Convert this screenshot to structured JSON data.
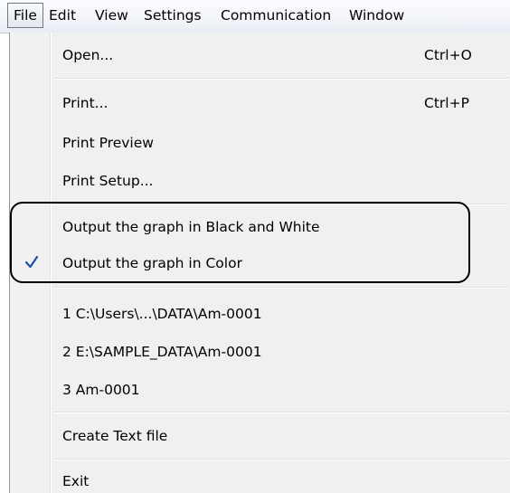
{
  "menubar": {
    "items": [
      "File",
      "Edit",
      "View",
      "Settings",
      "Communication",
      "Window"
    ]
  },
  "menu": {
    "open": {
      "label": "Open...",
      "shortcut": "Ctrl+O"
    },
    "print": {
      "label": "Print...",
      "shortcut": "Ctrl+P"
    },
    "print_preview": "Print Preview",
    "print_setup": "Print Setup...",
    "output_bw": "Output the graph in Black and White",
    "output_color": "Output the graph in Color",
    "recent_files": [
      "1 C:\\Users\\...\\DATA\\Am-0001",
      "2 E:\\SAMPLE_DATA\\Am-0001",
      "3 Am-0001"
    ],
    "create_text": "Create Text file",
    "exit": "Exit"
  },
  "icons": {
    "checked_item": "checkmark-icon"
  },
  "colors": {
    "checkmark": "#1e4fa8",
    "callout_border": "#000000"
  }
}
